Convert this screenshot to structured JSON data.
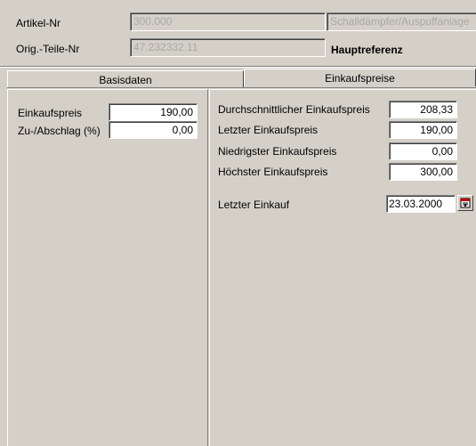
{
  "header": {
    "artikel_label": "Artikel-Nr",
    "artikel_value": "300.000",
    "artikel_desc": "Schalldämpfer/Auspuffanlage",
    "orig_label": "Orig.-Teile-Nr",
    "orig_value": "47.232332.11",
    "hauptreferenz": "Hauptreferenz"
  },
  "tabs": [
    {
      "label": "Basisdaten"
    },
    {
      "label": "Einkaufspreise"
    }
  ],
  "left_panel": {
    "einkaufspreis_label": "Einkaufspreis",
    "einkaufspreis_value": "190,00",
    "zuschlag_label": "Zu-/Abschlag (%)",
    "zuschlag_value": "0,00"
  },
  "right_panel": {
    "avg_label": "Durchschnittlicher Einkaufspreis",
    "avg_value": "208,33",
    "last_label": "Letzter Einkaufspreis",
    "last_value": "190,00",
    "min_label": "Niedrigster Einkaufspreis",
    "min_value": "0,00",
    "max_label": "Höchster Einkaufspreis",
    "max_value": "300,00",
    "last_purchase_label": "Letzter Einkauf",
    "last_purchase_value": "23.03.2000"
  },
  "icons": {
    "calendar": "calendar-icon"
  }
}
